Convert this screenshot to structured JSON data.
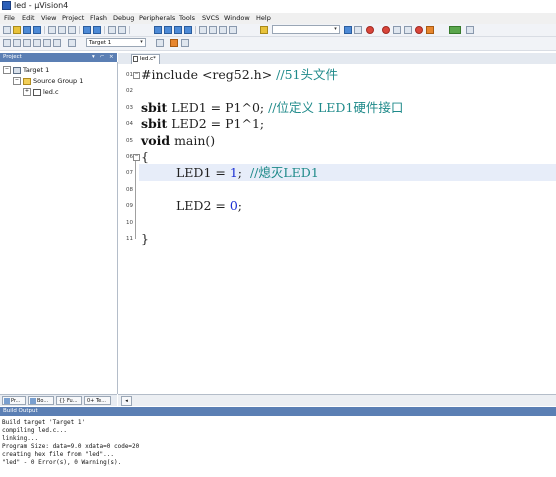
{
  "window": {
    "title": "led - µVision4"
  },
  "menu": [
    "File",
    "Edit",
    "View",
    "Project",
    "Flash",
    "Debug",
    "Peripherals",
    "Tools",
    "SVCS",
    "Window",
    "Help"
  ],
  "toolbar2": {
    "target_combo": "Target 1"
  },
  "project_panel": {
    "title": "Project",
    "tree": {
      "target": "Target 1",
      "group": "Source Group 1",
      "file": "led.c"
    },
    "tabs": [
      "Pr...",
      "Bo...",
      "{} Fu...",
      "0+ Te..."
    ]
  },
  "editor": {
    "tab_label": "led.c*",
    "line_numbers": [
      "01",
      "02",
      "03",
      "04",
      "05",
      "06",
      "07",
      "08",
      "09",
      "10",
      "11"
    ],
    "code": {
      "l1_pre": "#include <reg52.h> ",
      "l1_comment": "//51头文件",
      "l3_kw": "sbit",
      "l3_code": " LED1 = P1^0; ",
      "l3_comment": "//位定义 LED1硬件接口",
      "l4_kw": "sbit",
      "l4_code": " LED2 = P1^1;",
      "l5_kw": "void",
      "l5_code": " main()",
      "l6": "{",
      "l7_code": "LED1 = ",
      "l7_num": "1",
      "l7_semi": ";",
      "l7_comment": "//熄灭LED1",
      "l9_code": "LED2 = ",
      "l9_num": "0",
      "l9_semi": ";",
      "l11": "}"
    }
  },
  "build_output": {
    "title": "Build Output",
    "lines": [
      "Build target 'Target 1'",
      "compiling led.c...",
      "linking...",
      "Program Size: data=9.0 xdata=0 code=20",
      "creating hex file from \"led\"...",
      "\"led\" - 0 Error(s), 0 Warning(s)."
    ]
  }
}
